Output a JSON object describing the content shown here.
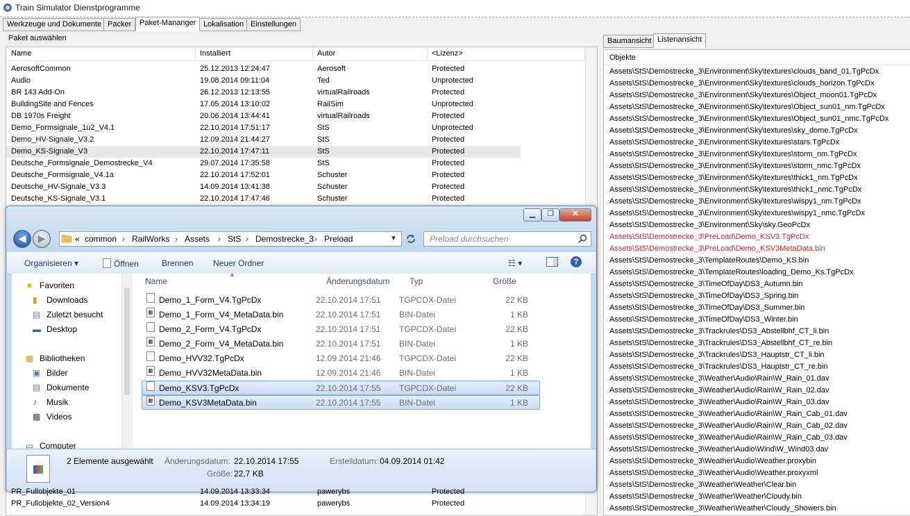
{
  "app": {
    "title": "Train Simulator Dienstprogramme"
  },
  "tabs": [
    "Werkzeuge und Dokumente",
    "Packer",
    "Paket-Mananger",
    "Lokalisation",
    "Einstellungen"
  ],
  "active_tab": "Paket-Mananger",
  "packages": {
    "label": "Paket auswählen",
    "columns": [
      "Name",
      "Installiert",
      "Autor",
      "<Lizenz>"
    ],
    "rows": [
      [
        "AerosoftCommon",
        "25.12.2013 12:24:47",
        "Aerosoft",
        "Protected"
      ],
      [
        "Audio",
        "19.08.2014 09:11:04",
        "Ted",
        "Unprotected"
      ],
      [
        "BR 143 Add-On",
        "26.12.2013 12:13:55",
        "virtualRailroads",
        "Protected"
      ],
      [
        "BuildingSite and Fences",
        "17.05.2014 13:10:02",
        "RailSim",
        "Unprotected"
      ],
      [
        "DB 1970s Freight",
        "20.06.2014 13:44:41",
        "virtualRailroads",
        "Protected"
      ],
      [
        "Demo_Formsignale_1u2_V4.1",
        "22.10.2014 17:51:17",
        "StS",
        "Unprotected"
      ],
      [
        "Demo_HV-Signale_V3.2",
        "12.09.2014 21:44:27",
        "StS",
        "Protected"
      ],
      [
        "Demo_KS-Signale_V3",
        "22.10.2014 17:47:11",
        "StS",
        "Protected"
      ],
      [
        "Deutsche_Formsignale_Demostrecke_V4",
        "29.07.2014 17:35:58",
        "StS",
        "Protected"
      ],
      [
        "Deutsche_Formsignale_V4.1a",
        "22.10.2014 17:52:01",
        "Schuster",
        "Protected"
      ],
      [
        "Deutsche_HV-Signale_V3.3",
        "14.09.2014 13:41:38",
        "Schuster",
        "Protected"
      ],
      [
        "Deutsche_KS-Signale_V3.1",
        "22.10.2014 17:47:46",
        "Schuster",
        "Protected"
      ]
    ],
    "bottom_rows": [
      [
        "PR_Fullobjekte_01",
        "14.09.2014 13:33:34",
        "pawerybs",
        "Protected"
      ],
      [
        "PR_Fullobjekte_02_Version4",
        "14.09.2014 13:34:19",
        "pawerybs",
        "Protected"
      ]
    ]
  },
  "right_tabs": [
    "Baumansicht",
    "Listenansicht"
  ],
  "objects": {
    "header": "Objekte",
    "items": [
      {
        "path": "Assets\\StS\\Demostrecke_3\\Environment\\Sky\\textures\\clouds_band_01.TgPcDx",
        "red": false
      },
      {
        "path": "Assets\\StS\\Demostrecke_3\\Environment\\Sky\\textures\\clouds_horizon.TgPcDx",
        "red": false
      },
      {
        "path": "Assets\\StS\\Demostrecke_3\\Environment\\Sky\\textures\\Object_moon01.TgPcDx",
        "red": false
      },
      {
        "path": "Assets\\StS\\Demostrecke_3\\Environment\\Sky\\textures\\Object_sun01_nm.TgPcDx",
        "red": false
      },
      {
        "path": "Assets\\StS\\Demostrecke_3\\Environment\\Sky\\textures\\Object_sun01_nmc.TgPcDx",
        "red": false
      },
      {
        "path": "Assets\\StS\\Demostrecke_3\\Environment\\Sky\\textures\\sky_dome.TgPcDx",
        "red": false
      },
      {
        "path": "Assets\\StS\\Demostrecke_3\\Environment\\Sky\\textures\\stars.TgPcDx",
        "red": false
      },
      {
        "path": "Assets\\StS\\Demostrecke_3\\Environment\\Sky\\textures\\storm_nm.TgPcDx",
        "red": false
      },
      {
        "path": "Assets\\StS\\Demostrecke_3\\Environment\\Sky\\textures\\storm_nmc.TgPcDx",
        "red": false
      },
      {
        "path": "Assets\\StS\\Demostrecke_3\\Environment\\Sky\\textures\\thick1_nm.TgPcDx",
        "red": false
      },
      {
        "path": "Assets\\StS\\Demostrecke_3\\Environment\\Sky\\textures\\thick1_nmc.TgPcDx",
        "red": false
      },
      {
        "path": "Assets\\StS\\Demostrecke_3\\Environment\\Sky\\textures\\wispy1_nm.TgPcDx",
        "red": false
      },
      {
        "path": "Assets\\StS\\Demostrecke_3\\Environment\\Sky\\textures\\wispy1_nmc.TgPcDx",
        "red": false
      },
      {
        "path": "Assets\\StS\\Demostrecke_3\\Environment\\Sky\\sky.GeoPcDx",
        "red": false
      },
      {
        "path": "Assets\\StS\\Demostrecke_3\\PreLoad\\Demo_KSV3.TgPcDx",
        "red": true
      },
      {
        "path": "Assets\\StS\\Demostrecke_3\\PreLoad\\Demo_KSV3MetaData.bin",
        "red": true
      },
      {
        "path": "Assets\\StS\\Demostrecke_3\\TemplateRoutes\\Demo_KS.bin",
        "red": false
      },
      {
        "path": "Assets\\StS\\Demostrecke_3\\TemplateRoutes\\loading_Demo_Ks.TgPcDx",
        "red": false
      },
      {
        "path": "Assets\\StS\\Demostrecke_3\\TimeOfDay\\DS3_Autumn.bin",
        "red": false
      },
      {
        "path": "Assets\\StS\\Demostrecke_3\\TimeOfDay\\DS3_Spring.bin",
        "red": false
      },
      {
        "path": "Assets\\StS\\Demostrecke_3\\TimeOfDay\\DS3_Summer.bin",
        "red": false
      },
      {
        "path": "Assets\\StS\\Demostrecke_3\\TimeOfDay\\DS3_Winter.bin",
        "red": false
      },
      {
        "path": "Assets\\StS\\Demostrecke_3\\Trackrules\\DS3_Abstellbhf_CT_li.bin",
        "red": false
      },
      {
        "path": "Assets\\StS\\Demostrecke_3\\Trackrules\\DS3_Abstellbhf_CT_re.bin",
        "red": false
      },
      {
        "path": "Assets\\StS\\Demostrecke_3\\Trackrules\\DS3_Hauptstr_CT_li.bin",
        "red": false
      },
      {
        "path": "Assets\\StS\\Demostrecke_3\\Trackrules\\DS3_Hauptstr_CT_re.bin",
        "red": false
      },
      {
        "path": "Assets\\StS\\Demostrecke_3\\Weather\\Audio\\Rain\\W_Rain_01.dav",
        "red": false
      },
      {
        "path": "Assets\\StS\\Demostrecke_3\\Weather\\Audio\\Rain\\W_Rain_02.dav",
        "red": false
      },
      {
        "path": "Assets\\StS\\Demostrecke_3\\Weather\\Audio\\Rain\\W_Rain_03.dav",
        "red": false
      },
      {
        "path": "Assets\\StS\\Demostrecke_3\\Weather\\Audio\\Rain\\W_Rain_Cab_01.dav",
        "red": false
      },
      {
        "path": "Assets\\StS\\Demostrecke_3\\Weather\\Audio\\Rain\\W_Rain_Cab_02.dav",
        "red": false
      },
      {
        "path": "Assets\\StS\\Demostrecke_3\\Weather\\Audio\\Rain\\W_Rain_Cab_03.dav",
        "red": false
      },
      {
        "path": "Assets\\StS\\Demostrecke_3\\Weather\\Audio\\Wind\\W_Wind03.dav",
        "red": false
      },
      {
        "path": "Assets\\StS\\Demostrecke_3\\Weather\\Audio\\Weather.proxybin",
        "red": false
      },
      {
        "path": "Assets\\StS\\Demostrecke_3\\Weather\\Audio\\Weather.proxyxml",
        "red": false
      },
      {
        "path": "Assets\\StS\\Demostrecke_3\\Weather\\Weather\\Clear.bin",
        "red": false
      },
      {
        "path": "Assets\\StS\\Demostrecke_3\\Weather\\Weather\\Cloudy.bin",
        "red": false
      },
      {
        "path": "Assets\\StS\\Demostrecke_3\\Weather\\Weather\\Cloudy_Showers.bin",
        "red": false
      }
    ]
  },
  "explorer": {
    "breadcrumb": [
      "«",
      "common",
      "RailWorks",
      "Assets",
      "StS",
      "Demostrecke_3",
      "Preload"
    ],
    "search_placeholder": "Preload durchsuchen",
    "toolbar": {
      "organize": "Organisieren",
      "open": "Öffnen",
      "burn": "Brennen",
      "new_folder": "Neuer Ordner"
    },
    "nav": {
      "favorites": "Favoriten",
      "downloads": "Downloads",
      "recent": "Zuletzt besucht",
      "desktop": "Desktop",
      "libraries": "Bibliotheken",
      "pictures": "Bilder",
      "documents": "Dokumente",
      "music": "Musik",
      "videos": "Videos",
      "computer": "Computer"
    },
    "columns": [
      "Name",
      "Änderungsdatum",
      "Typ",
      "Größe"
    ],
    "files": [
      {
        "name": "Demo_1_Form_V4.TgPcDx",
        "date": "22.10.2014 17:51",
        "type": "TGPCDX-Datei",
        "size": "22 KB",
        "kind": "doc",
        "selected": false
      },
      {
        "name": "Demo_1_Form_V4_MetaData.bin",
        "date": "22.10.2014 17:51",
        "type": "BIN-Datei",
        "size": "1 KB",
        "kind": "bin",
        "selected": false
      },
      {
        "name": "Demo_2_Form_V4.TgPcDx",
        "date": "22.10.2014 17:51",
        "type": "TGPCDX-Datei",
        "size": "22 KB",
        "kind": "doc",
        "selected": false
      },
      {
        "name": "Demo_2_Form_V4_MetaData.bin",
        "date": "22.10.2014 17:51",
        "type": "BIN-Datei",
        "size": "1 KB",
        "kind": "bin",
        "selected": false
      },
      {
        "name": "Demo_HVV32.TgPcDx",
        "date": "12.09.2014 21:46",
        "type": "TGPCDX-Datei",
        "size": "22 KB",
        "kind": "doc",
        "selected": false
      },
      {
        "name": "Demo_HVV32MetaData.bin",
        "date": "12.09.2014 21:46",
        "type": "BIN-Datei",
        "size": "1 KB",
        "kind": "bin",
        "selected": false
      },
      {
        "name": "Demo_KSV3.TgPcDx",
        "date": "22.10.2014 17:55",
        "type": "TGPCDX-Datei",
        "size": "22 KB",
        "kind": "doc",
        "selected": true
      },
      {
        "name": "Demo_KSV3MetaData.bin",
        "date": "22.10.2014 17:55",
        "type": "BIN-Datei",
        "size": "1 KB",
        "kind": "bin",
        "selected": true
      }
    ],
    "status": {
      "selected": "2 Elemente ausgewählt",
      "modified_label": "Änderungsdatum:",
      "modified_value": "22.10.2014 17:55",
      "created_label": "Erstelldatum:",
      "created_value": "04.09.2014 01:42",
      "size_label": "Größe:",
      "size_value": "22,7 KB"
    }
  }
}
